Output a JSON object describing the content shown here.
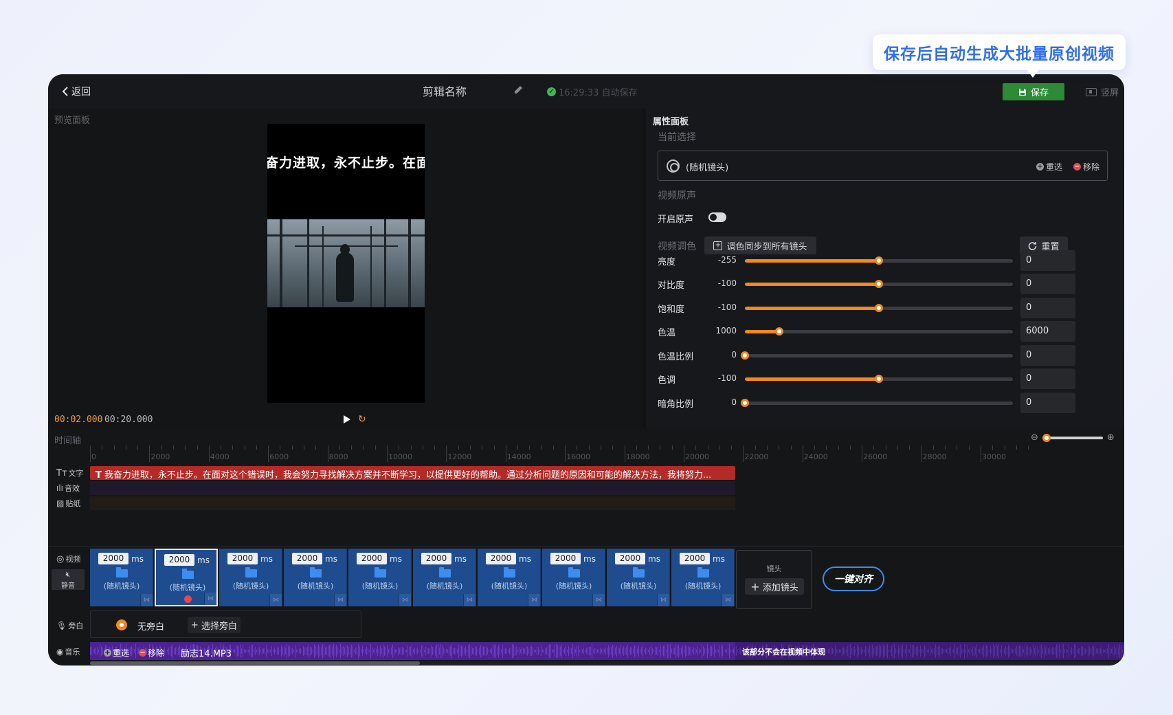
{
  "callout": "保存后自动生成大批量原创视频",
  "topbar": {
    "back_label": "返回",
    "project_title": "剪辑名称",
    "autosave_text": "16:29:33 自动保存",
    "save_label": "保存",
    "vertical_label": "竖屏"
  },
  "preview": {
    "panel_label": "预览面板",
    "subtitle": "奋力进取，永不止步。在面",
    "current_time": "00:02.000",
    "total_time": "00:20.000"
  },
  "props": {
    "panel_label": "属性面板",
    "current_selection_label": "当前选择",
    "selection_text": "(随机镜头)",
    "reselect_label": "重选",
    "remove_label": "移除",
    "audio_section_label": "视频原声",
    "toggle_label": "开启原声",
    "toggle_on": false,
    "color_section_label": "视频调色",
    "sync_label": "调色同步到所有镜头",
    "reset_label": "重置",
    "sliders": [
      {
        "name": "亮度",
        "min": "-255",
        "max": "255",
        "value": "0",
        "fraction": 0.5
      },
      {
        "name": "对比度",
        "min": "-100",
        "max": "100",
        "value": "0",
        "fraction": 0.5
      },
      {
        "name": "饱和度",
        "min": "-100",
        "max": "100",
        "value": "0",
        "fraction": 0.5
      },
      {
        "name": "色温",
        "min": "1000",
        "max": "40000",
        "value": "6000",
        "fraction": 0.128
      },
      {
        "name": "色温比例",
        "min": "0",
        "max": "100",
        "value": "0",
        "fraction": 0.0
      },
      {
        "name": "色调",
        "min": "-100",
        "max": "100",
        "value": "0",
        "fraction": 0.5
      },
      {
        "name": "暗角比例",
        "min": "0",
        "max": "100",
        "value": "0",
        "fraction": 0.0
      }
    ]
  },
  "timeline": {
    "label": "时间轴",
    "ruler": [
      "0",
      "2000",
      "4000",
      "6000",
      "8000",
      "10000",
      "12000",
      "14000",
      "16000",
      "18000",
      "20000",
      "22000",
      "24000",
      "26000",
      "28000",
      "30000"
    ],
    "tracks": {
      "text": "文字",
      "sfx": "音效",
      "sticker": "贴纸",
      "video": "视频",
      "mute": "静音",
      "voice": "旁白",
      "music": "音乐"
    },
    "text_clip": "我奋力进取，永不止步。在面对这个错误时，我会努力寻找解决方案并不断学习，以提供更好的帮助。通过分析问题的原因和可能的解决方法，我将努力...",
    "clips": [
      {
        "duration": "2000",
        "unit": "ms",
        "name": "(随机镜头)"
      },
      {
        "duration": "2000",
        "unit": "ms",
        "name": "(随机镜头)",
        "selected": true
      },
      {
        "duration": "2000",
        "unit": "ms",
        "name": "(随机镜头)"
      },
      {
        "duration": "2000",
        "unit": "ms",
        "name": "(随机镜头)"
      },
      {
        "duration": "2000",
        "unit": "ms",
        "name": "(随机镜头)"
      },
      {
        "duration": "2000",
        "unit": "ms",
        "name": "(随机镜头)"
      },
      {
        "duration": "2000",
        "unit": "ms",
        "name": "(随机镜头)"
      },
      {
        "duration": "2000",
        "unit": "ms",
        "name": "(随机镜头)"
      },
      {
        "duration": "2000",
        "unit": "ms",
        "name": "(随机镜头)"
      },
      {
        "duration": "2000",
        "unit": "ms",
        "name": "(随机镜头)"
      }
    ],
    "add_shot_label": "镜头",
    "add_shot_button": "添加镜头",
    "align_button": "一键对齐",
    "voice_none": "无旁白",
    "voice_select": "选择旁白",
    "music_reselect": "重选",
    "music_remove": "移除",
    "music_file": "励志14.MP3",
    "music_note": "该部分不会在视频中体现"
  },
  "colors": {
    "accent": "#f08a1c",
    "save_green": "#2d8a36",
    "clip_blue": "#1e4c8f",
    "text_red": "#b42a27",
    "music_purple": "#4a2391",
    "callout_blue": "#2f6ef0"
  }
}
